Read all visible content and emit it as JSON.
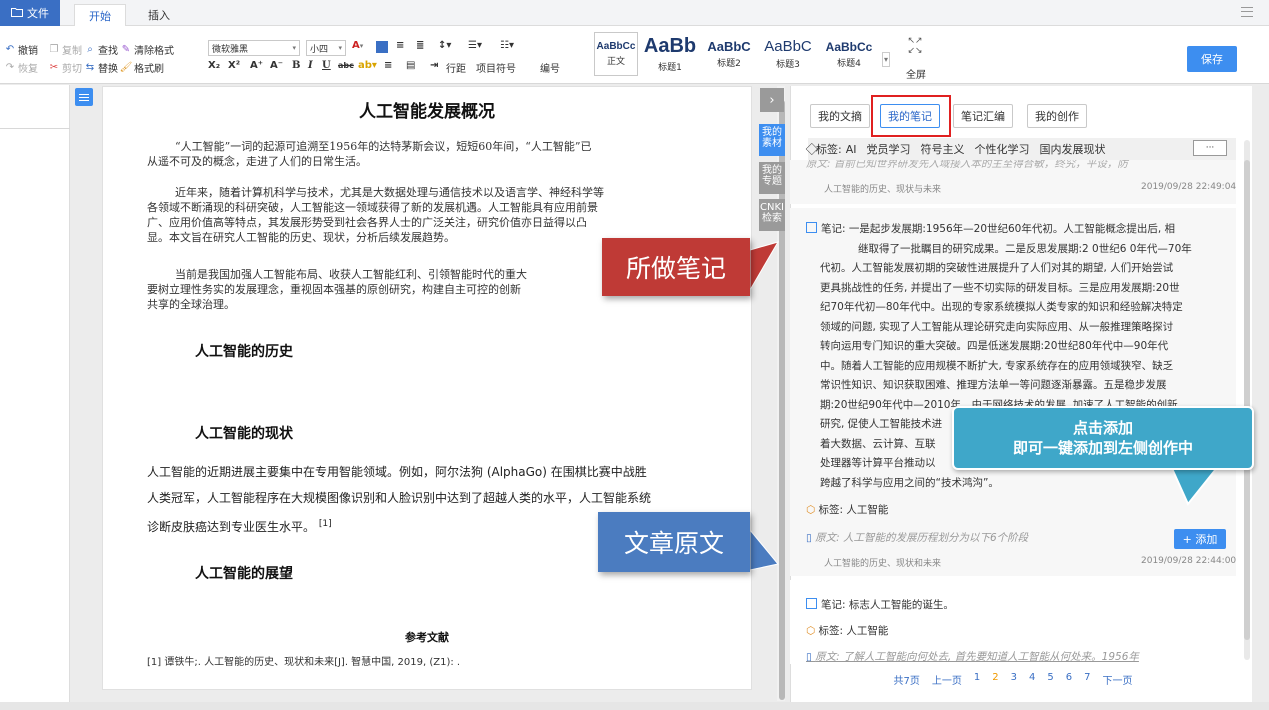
{
  "tabs": {
    "file": "文件",
    "start": "开始",
    "insert": "插入"
  },
  "ribbon": {
    "undo": "撤销",
    "redo": "恢复",
    "copy": "复制",
    "cut": "剪切",
    "find": "查找",
    "replace": "替换",
    "clear_format": "清除格式",
    "format_painter": "格式刷",
    "font_family": "微软雅黑",
    "font_size": "小四",
    "line_spacing": "行距",
    "bullets": "项目符号",
    "numbering": "编号",
    "styles": [
      {
        "sample": "AaBbCc",
        "caption": "正文"
      },
      {
        "sample": "AaBb",
        "caption": "标题1"
      },
      {
        "sample": "AaBbC",
        "caption": "标题2"
      },
      {
        "sample": "AaBbC",
        "caption": "标题3"
      },
      {
        "sample": "AaBbCc",
        "caption": "标题4"
      }
    ],
    "fullscreen": "全屏",
    "save": "保存"
  },
  "side_tabs": {
    "material": "我的素材",
    "topic": "我的专题",
    "cnki": "CNKI检索"
  },
  "document": {
    "title": "人工智能发展概况",
    "paragraphs": [
      [
        "“人工智能”一词的起源可追溯至1956年的达特茅斯会议，短短60年间，“人工智能”已",
        "从遥不可及的概念，走进了人们的日常生活。"
      ],
      [
        "近年来，随着计算机科学与技术，尤其是大数据处理与通信技术以及语言学、神经科学等",
        "各领域不断涌现的科研突破，人工智能这一领域获得了新的发展机遇。人工智能具有应用前景",
        "广、应用价值高等特点，其发展形势受到社会各界人士的广泛关注，研究价值亦日益得以凸",
        "显。本文旨在研究人工智能的历史、现状，分析后续发展趋势。"
      ],
      [
        "当前是我国加强人工智能布局、收获人工智能红利、引领智能时代的重大",
        "要树立理性务实的发展理念，重视固本强基的原创研究，构建自主可控的创新",
        "共享的全球治理。"
      ]
    ],
    "h_history": "人工智能的历史",
    "h_status": "人工智能的现状",
    "status_lines": [
      "人工智能的近期进展主要集中在专用智能领域。例如，阿尔法狗 (AlphaGo) 在围棋比赛中战胜",
      "人类冠军，人工智能程序在大规模图像识别和人脸识别中达到了超越人类的水平，人工智能系统",
      "诊断皮肤癌达到专业医生水平。"
    ],
    "citation": "[1]",
    "h_outlook": "人工智能的展望",
    "refs_title": "参考文献",
    "ref_1": "[1] 谭铁牛;. 人工智能的历史、现状和未来[J]. 智慧中国, 2019, (Z1): ."
  },
  "right_panel": {
    "tabs": [
      "我的文摘",
      "我的笔记",
      "笔记汇编",
      "我的创作"
    ],
    "tag_prefix": "标签:",
    "tag_filters": [
      "AI",
      "党员学习",
      "符号主义",
      "个性化学习",
      "国内发展现状"
    ],
    "more": "···",
    "first_note_partial": "原文: 首前已知世界研发先入域接入本的主至得合敏，终究，平设，防",
    "first_note_source": "人工智能的历史、现状与未来",
    "first_note_time": "2019/09/28 22:49:04",
    "note2_lines": [
      "笔记: 一是起步发展期:1956年—20世纪60年代初。人工智能概念提出后, 相",
      "继取得了一批瞩目的研究成果。二是反思发展期:2 0世纪6 0年代—70年",
      "代初。人工智能发展初期的突破性进展提升了人们对其的期望, 人们开始尝试",
      "更具挑战性的任务, 并提出了一些不切实际的研发目标。三是应用发展期:20世",
      "纪70年代初—80年代中。出现的专家系统模拟人类专家的知识和经验解决特定",
      "领域的问题, 实现了人工智能从理论研究走向实际应用、从一般推理策略探讨",
      "转向运用专门知识的重大突破。四是低迷发展期:20世纪80年代中—90年代",
      "中。随着人工智能的应用规模不断扩大, 专家系统存在的应用领域狭窄、缺乏",
      "常识性知识、知识获取困难、推理方法单一等问题逐渐暴露。五是稳步发展",
      "期:20世纪90年代中—2010年。由于网络技术的发展, 加速了人工智能的创新",
      "研究, 促使人工智能技术进",
      "着大数据、云计算、互联",
      "处理器等计算平台推动以",
      "跨越了科学与应用之间的“技术鸿沟”。"
    ],
    "note2_tag": "标签: 人工智能",
    "note2_origin": "原文: 人工智能的发展历程划分为以下6个阶段",
    "add_button": "+ 添加",
    "note2_source": "人工智能的历史、现状和未来",
    "note2_time": "2019/09/28 22:44:00",
    "note3_line": "笔记: 标志人工智能的诞生。",
    "note3_tag": "标签: 人工智能",
    "note3_origin": "原文: 了解人工智能向何处去, 首先要知道人工智能从何处来。1956年"
  },
  "pager": {
    "total": "共7页",
    "prev": "上一页",
    "pages": [
      "1",
      "2",
      "3",
      "4",
      "5",
      "6",
      "7"
    ],
    "current": "2",
    "next": "下一页"
  },
  "callouts": {
    "notes": "所做笔记",
    "original": "文章原文",
    "add_line1": "点击添加",
    "add_line2": "即可一键添加到左侧创作中"
  },
  "colors": {
    "accent": "#3d8ef0",
    "red_callout": "#bf3a36",
    "blue_callout": "#4b7cc0",
    "cyan_callout": "#3fa7c9",
    "highlight": "#e02020"
  }
}
